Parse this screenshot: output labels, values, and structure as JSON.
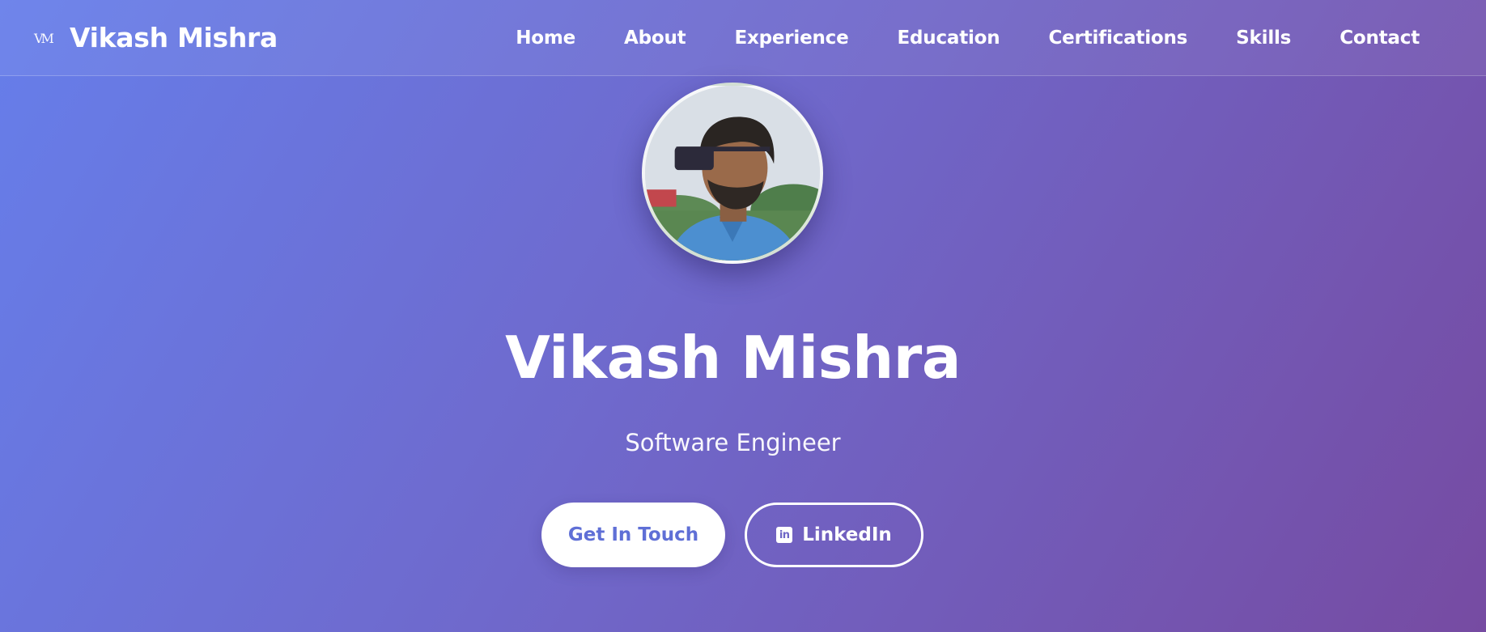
{
  "brand": {
    "logo_text": "VM",
    "name": "Vikash Mishra"
  },
  "nav": {
    "links": [
      {
        "label": "Home"
      },
      {
        "label": "About"
      },
      {
        "label": "Experience"
      },
      {
        "label": "Education"
      },
      {
        "label": "Certifications"
      },
      {
        "label": "Skills"
      },
      {
        "label": "Contact"
      }
    ]
  },
  "hero": {
    "name": "Vikash Mishra",
    "title": "Software Engineer",
    "buttons": {
      "primary": "Get In Touch",
      "secondary": "LinkedIn",
      "secondary_icon": "linkedin-icon"
    }
  },
  "theme": {
    "gradient_start": "#667eea",
    "gradient_end": "#764ba2",
    "primary_button_text": "#5f6fd6"
  }
}
